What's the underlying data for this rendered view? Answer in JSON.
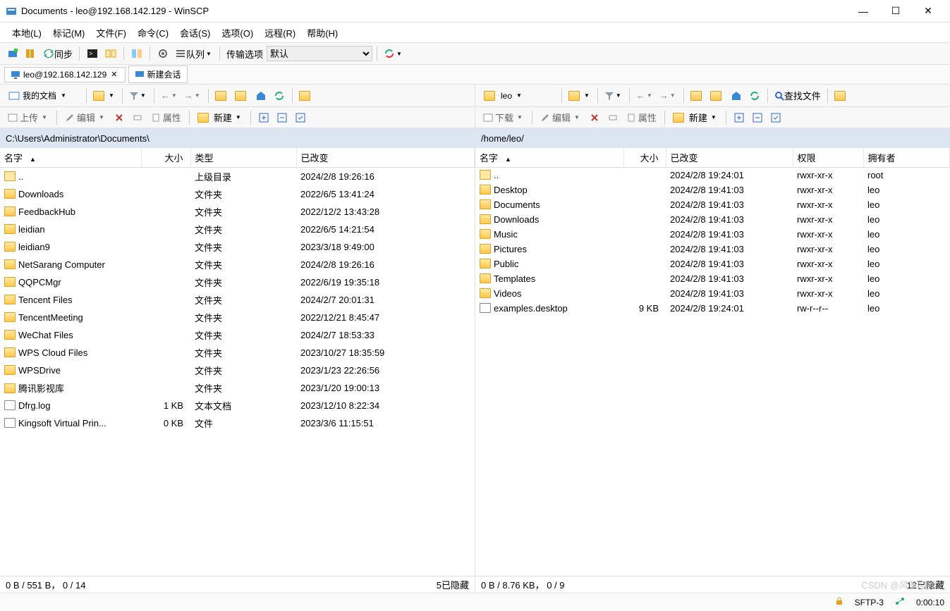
{
  "window": {
    "title": "Documents - leo@192.168.142.129 - WinSCP"
  },
  "menus": [
    "本地(L)",
    "标记(M)",
    "文件(F)",
    "命令(C)",
    "会话(S)",
    "选项(O)",
    "远程(R)",
    "帮助(H)"
  ],
  "toolbar": {
    "sync_label": "同步",
    "queue_label": "队列",
    "transfer_label": "传输选项",
    "transfer_value": "默认"
  },
  "tabs": {
    "session": "leo@192.168.142.129",
    "new_session": "新建会话"
  },
  "local": {
    "drop_label": "我的文档",
    "path": "C:\\Users\\Administrator\\Documents\\",
    "actions": {
      "upload": "上传",
      "edit": "编辑",
      "props": "属性",
      "new": "新建"
    },
    "headers": {
      "name": "名字",
      "size": "大小",
      "type": "类型",
      "changed": "已改变"
    },
    "rows": [
      {
        "icon": "up",
        "name": "..",
        "size": "",
        "type": "上级目录",
        "changed": "2024/2/8  19:26:16"
      },
      {
        "icon": "folder",
        "name": "Downloads",
        "size": "",
        "type": "文件夹",
        "changed": "2022/6/5  13:41:24"
      },
      {
        "icon": "folder",
        "name": "FeedbackHub",
        "size": "",
        "type": "文件夹",
        "changed": "2022/12/2  13:43:28"
      },
      {
        "icon": "folder",
        "name": "leidian",
        "size": "",
        "type": "文件夹",
        "changed": "2022/6/5  14:21:54"
      },
      {
        "icon": "folder",
        "name": "leidian9",
        "size": "",
        "type": "文件夹",
        "changed": "2023/3/18  9:49:00"
      },
      {
        "icon": "folder",
        "name": "NetSarang Computer",
        "size": "",
        "type": "文件夹",
        "changed": "2024/2/8  19:26:16"
      },
      {
        "icon": "folder",
        "name": "QQPCMgr",
        "size": "",
        "type": "文件夹",
        "changed": "2022/6/19  19:35:18"
      },
      {
        "icon": "folder",
        "name": "Tencent Files",
        "size": "",
        "type": "文件夹",
        "changed": "2024/2/7  20:01:31"
      },
      {
        "icon": "folder",
        "name": "TencentMeeting",
        "size": "",
        "type": "文件夹",
        "changed": "2022/12/21  8:45:47"
      },
      {
        "icon": "folder",
        "name": "WeChat Files",
        "size": "",
        "type": "文件夹",
        "changed": "2024/2/7  18:53:33"
      },
      {
        "icon": "folder",
        "name": "WPS Cloud Files",
        "size": "",
        "type": "文件夹",
        "changed": "2023/10/27  18:35:59"
      },
      {
        "icon": "folder",
        "name": "WPSDrive",
        "size": "",
        "type": "文件夹",
        "changed": "2023/1/23  22:26:56"
      },
      {
        "icon": "folder",
        "name": "腾讯影视库",
        "size": "",
        "type": "文件夹",
        "changed": "2023/1/20  19:00:13"
      },
      {
        "icon": "file",
        "name": "Dfrg.log",
        "size": "1 KB",
        "type": "文本文档",
        "changed": "2023/12/10  8:22:34"
      },
      {
        "icon": "file",
        "name": "Kingsoft Virtual Prin...",
        "size": "0 KB",
        "type": "文件",
        "changed": "2023/3/6  11:15:51"
      }
    ],
    "status_left": "0 B / 551 B， 0 / 14",
    "status_right": "5已隐藏"
  },
  "remote": {
    "drop_label": "leo",
    "path": "/home/leo/",
    "find_label": "查找文件",
    "actions": {
      "download": "下载",
      "edit": "编辑",
      "props": "属性",
      "new": "新建"
    },
    "headers": {
      "name": "名字",
      "size": "大小",
      "changed": "已改变",
      "rights": "权限",
      "owner": "拥有者"
    },
    "rows": [
      {
        "icon": "up",
        "name": "..",
        "size": "",
        "changed": "2024/2/8 19:24:01",
        "rights": "rwxr-xr-x",
        "owner": "root"
      },
      {
        "icon": "folder",
        "name": "Desktop",
        "size": "",
        "changed": "2024/2/8 19:41:03",
        "rights": "rwxr-xr-x",
        "owner": "leo"
      },
      {
        "icon": "folder",
        "name": "Documents",
        "size": "",
        "changed": "2024/2/8 19:41:03",
        "rights": "rwxr-xr-x",
        "owner": "leo"
      },
      {
        "icon": "folder",
        "name": "Downloads",
        "size": "",
        "changed": "2024/2/8 19:41:03",
        "rights": "rwxr-xr-x",
        "owner": "leo"
      },
      {
        "icon": "folder",
        "name": "Music",
        "size": "",
        "changed": "2024/2/8 19:41:03",
        "rights": "rwxr-xr-x",
        "owner": "leo"
      },
      {
        "icon": "folder",
        "name": "Pictures",
        "size": "",
        "changed": "2024/2/8 19:41:03",
        "rights": "rwxr-xr-x",
        "owner": "leo"
      },
      {
        "icon": "folder",
        "name": "Public",
        "size": "",
        "changed": "2024/2/8 19:41:03",
        "rights": "rwxr-xr-x",
        "owner": "leo"
      },
      {
        "icon": "folder",
        "name": "Templates",
        "size": "",
        "changed": "2024/2/8 19:41:03",
        "rights": "rwxr-xr-x",
        "owner": "leo"
      },
      {
        "icon": "folder",
        "name": "Videos",
        "size": "",
        "changed": "2024/2/8 19:41:03",
        "rights": "rwxr-xr-x",
        "owner": "leo"
      },
      {
        "icon": "file",
        "name": "examples.desktop",
        "size": "9 KB",
        "changed": "2024/2/8 19:24:01",
        "rights": "rw-r--r--",
        "owner": "leo"
      }
    ],
    "status_left": "0 B / 8.76 KB， 0 / 9",
    "status_right": "12已隐藏"
  },
  "statusbar": {
    "protocol": "SFTP-3",
    "time": "0:00:10"
  },
  "watermark": "CSDN @风筝超冷"
}
